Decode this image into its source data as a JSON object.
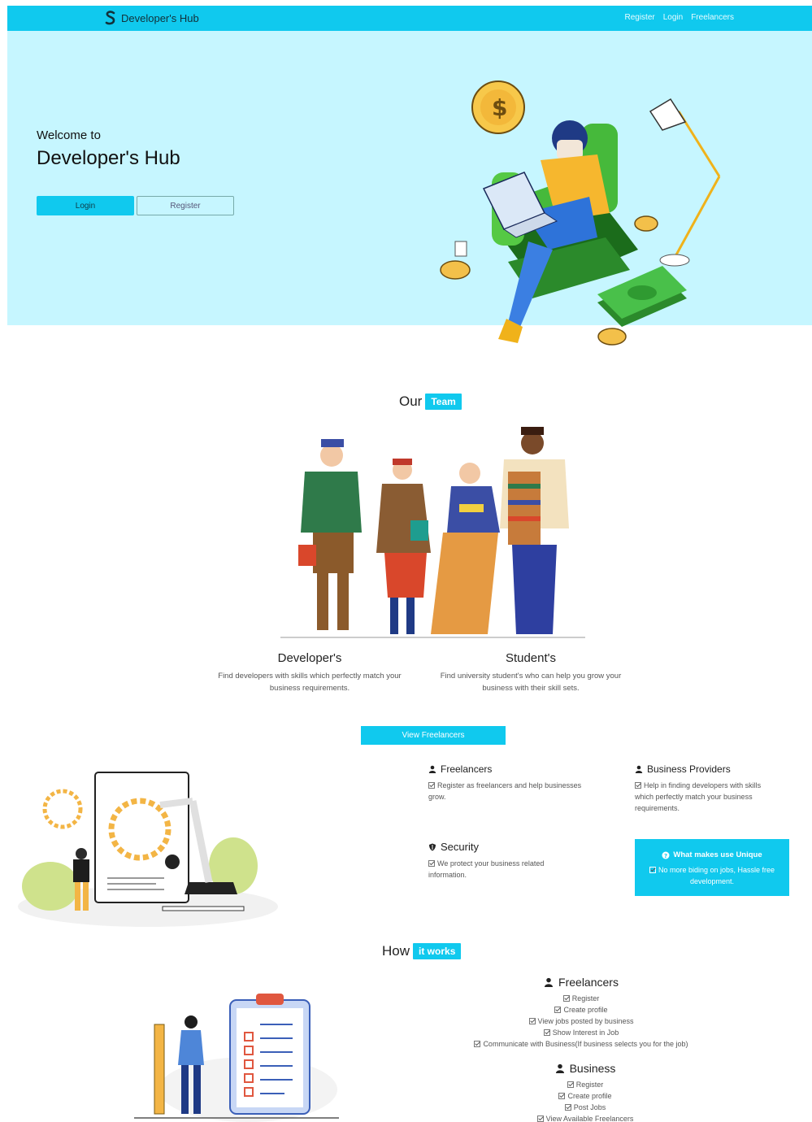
{
  "navbar": {
    "brand": "Developer's Hub",
    "links": [
      "Register",
      "Login",
      "Freelancers"
    ]
  },
  "hero": {
    "welcome": "Welcome to",
    "title": "Developer's Hub",
    "login_label": "Login",
    "register_label": "Register"
  },
  "team": {
    "title_plain": "Our",
    "title_tag": "Team",
    "developers": {
      "heading": "Developer's",
      "text": "Find developers with skills which perfectly match your business requirements."
    },
    "students": {
      "heading": "Student's",
      "text": "Find university student's who can help you grow your business with their skill sets."
    },
    "view_button": "View Freelancers"
  },
  "features": {
    "freelancers": {
      "heading": "Freelancers",
      "text": "Register as freelancers and help businesses grow."
    },
    "business_providers": {
      "heading": "Business Providers",
      "text": "Help in finding developers with skills which perfectly match your business requirements."
    },
    "security": {
      "heading": "Security",
      "text": "We protect your business related information."
    },
    "unique": {
      "heading": "What makes use Unique",
      "text": "No more biding on jobs, Hassle free development."
    }
  },
  "how": {
    "title_plain": "How",
    "title_tag": "it works",
    "freelancers": {
      "heading": "Freelancers",
      "steps": [
        "Register",
        "Create profile",
        "View jobs posted by business",
        "Show Interest in Job",
        "Communicate with Business(If business selects you for the job)"
      ]
    },
    "business": {
      "heading": "Business",
      "steps": [
        "Register",
        "Create profile",
        "Post Jobs",
        "View Available Freelancers"
      ]
    }
  },
  "colors": {
    "accent": "#10c9ee",
    "hero_bg": "#c6f6ff"
  }
}
